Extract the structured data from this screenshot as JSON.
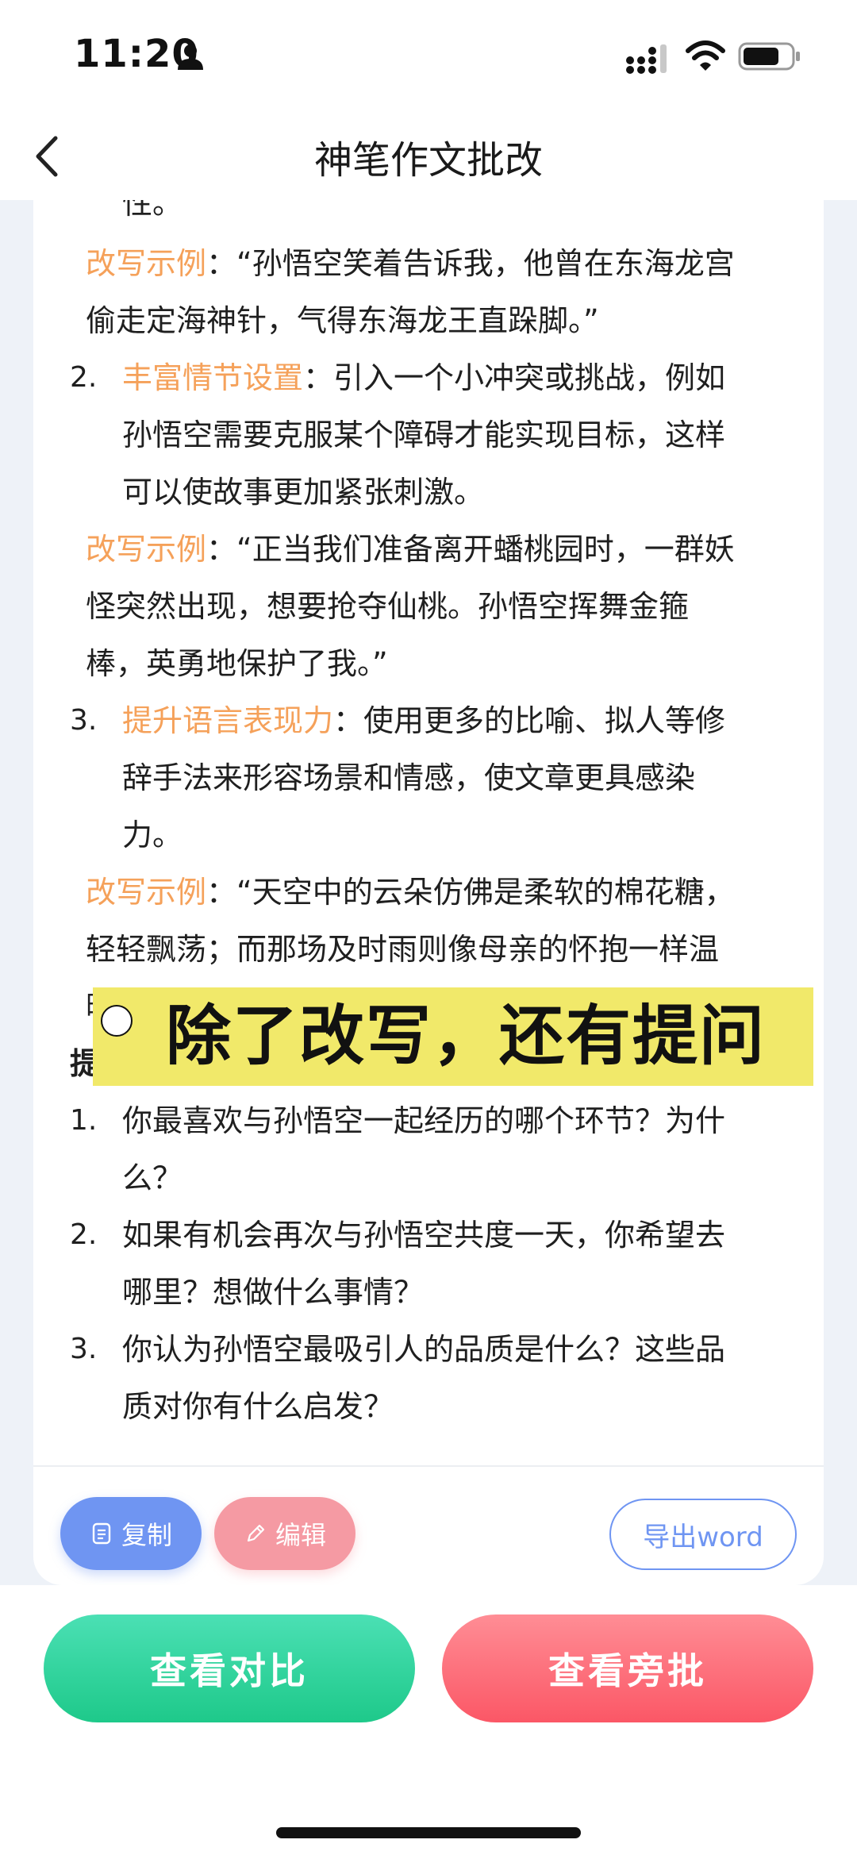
{
  "status": {
    "time": "11:20"
  },
  "nav": {
    "title": "神笔作文批改"
  },
  "content": {
    "lines": [
      "性。",
      [
        "改写示例",
        "：“孙悟空笑着告诉我，他曾在东海龙宫"
      ],
      "偷走定海神针，气得东海龙王直跺脚。”",
      [
        "丰富情节设置",
        "：引入一个小冲突或挑战，例如"
      ],
      "孙悟空需要克服某个障碍才能实现目标，这样",
      "可以使故事更加紧张刺激。",
      [
        "改写示例",
        "：“正当我们准备离开蟠桃园时，一群妖"
      ],
      "怪突然出现，想要抢夺仙桃。孙悟空挥舞金箍",
      "棒，英勇地保护了我。”",
      [
        "提升语言表现力",
        "：使用更多的比喻、拟人等修"
      ],
      "辞手法来形容场景和情感，使文章更具感染",
      "力。",
      [
        "改写示例",
        "：“天空中的云朵仿佛是柔软的棉花糖，"
      ],
      "轻轻飘荡；而那场及时雨则像母亲的怀抱一样温",
      "暖。”",
      "提",
      "你最喜欢与孙悟空一起经历的哪个环节？为什",
      "么？",
      "如果有机会再次与孙悟空共度一天，你希望去",
      "哪里？想做什么事情？",
      "你认为孙悟空最吸引人的品质是什么？这些品",
      "质对你有什么启发？"
    ],
    "numbers": [
      "2.",
      "3.",
      "1.",
      "2.",
      "3."
    ]
  },
  "banner": {
    "text": "除了改写，还有提问"
  },
  "card_actions": {
    "copy": "复制",
    "edit": "编辑",
    "export": "导出word"
  },
  "bottom": {
    "compare": "查看对比",
    "annotate": "查看旁批"
  },
  "colors": {
    "highlight": "#f5a15a",
    "copy_btn": "#6f95f2",
    "edit_btn": "#f59aa3",
    "compare_btn": "#1ec98a",
    "annotate_btn": "#fb5766",
    "banner": "#f1e96a"
  }
}
